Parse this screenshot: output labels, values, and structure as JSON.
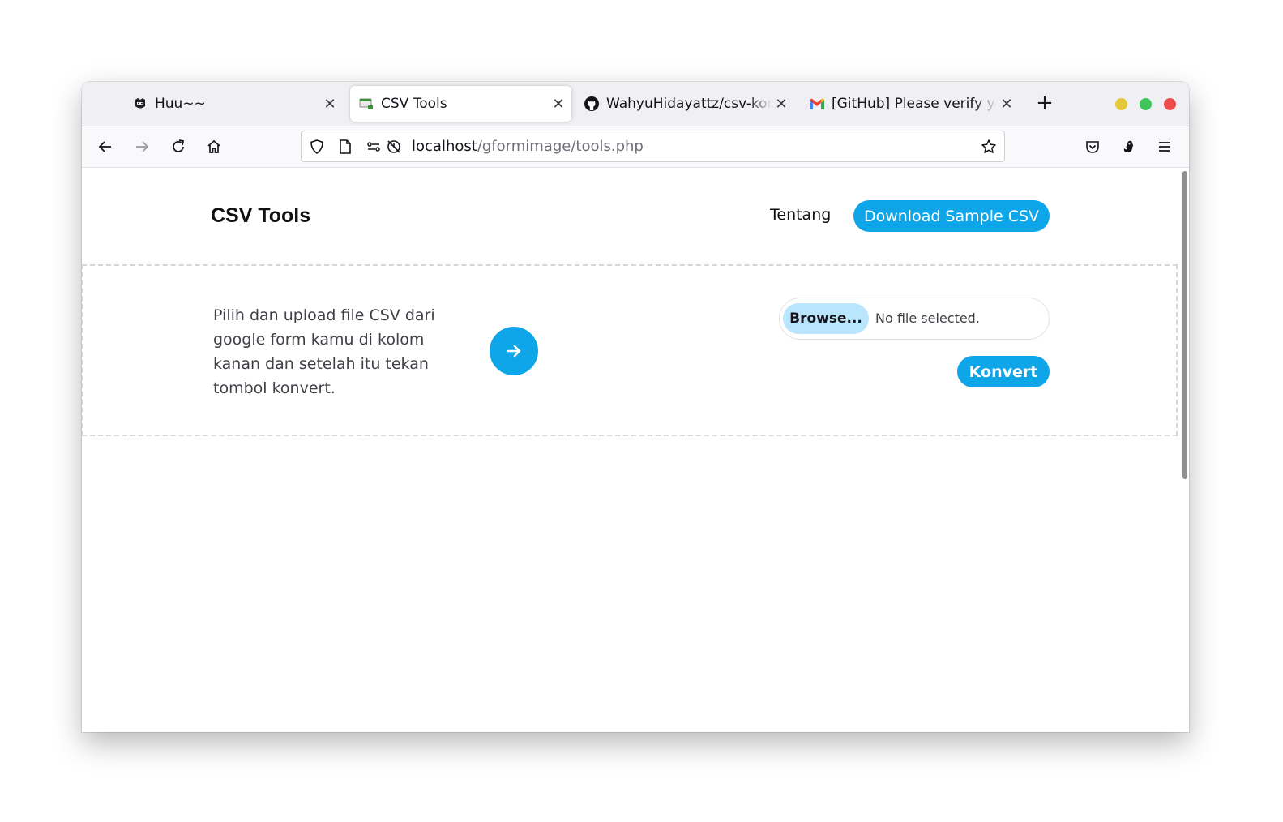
{
  "browser": {
    "tabs": [
      {
        "title": "Huu~~",
        "active": false
      },
      {
        "title": "CSV Tools",
        "active": true
      },
      {
        "title": "WahyuHidayattz/csv-konv",
        "active": false
      },
      {
        "title": "[GitHub] Please verify your",
        "active": false
      }
    ],
    "new_tab_icon": "plus-icon",
    "window_controls": {
      "minimize": "#e5c83a",
      "maximize": "#3fc55a",
      "close": "#ec4c4c"
    },
    "url": {
      "host": "localhost",
      "path": "/gformimage/tools.php"
    }
  },
  "page": {
    "brand": "CSV Tools",
    "nav_link": "Tentang",
    "download_button": "Download Sample CSV",
    "description": "Pilih dan upload file CSV dari google form kamu di kolom kanan dan setelah itu tekan tombol konvert.",
    "browse_button": "Browse...",
    "file_status": "No file selected.",
    "convert_button": "Konvert"
  },
  "colors": {
    "accent": "#0ea5e9",
    "browse_bg": "#bae6fd"
  }
}
